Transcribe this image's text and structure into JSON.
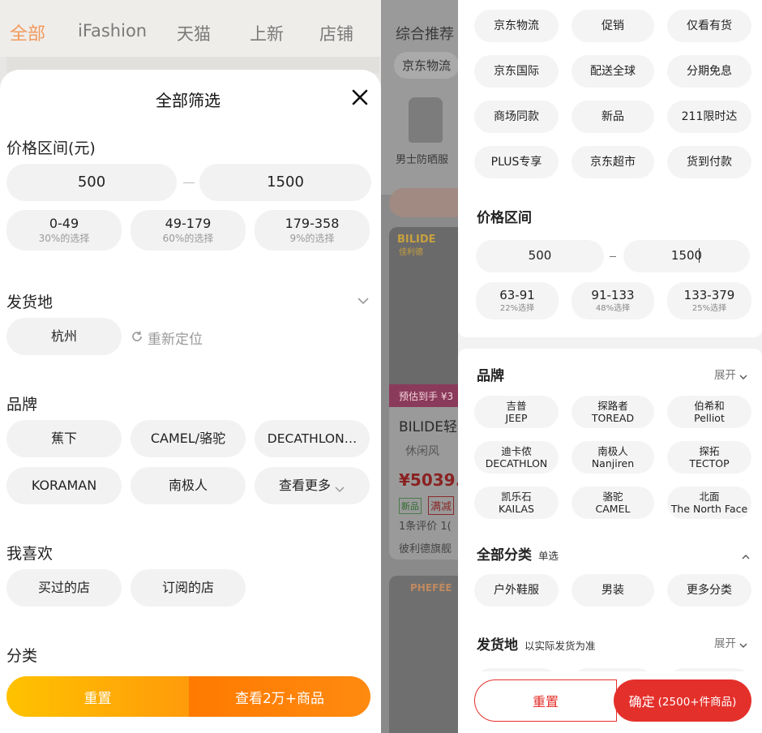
{
  "left_bg": {
    "tabs": [
      "全部",
      "iFashion",
      "天猫",
      "上新",
      "店铺"
    ]
  },
  "middle_bg": {
    "tab": "综合推荐",
    "chip": "京东物流",
    "item_label": "男士防晒服",
    "product_logo": "BILIDE",
    "product_logo_sub": "佳利德",
    "promo_text": "预估到手 ¥3",
    "product_title": "BILIDE轻",
    "product_style": "休闲风",
    "price": "¥5039.",
    "tags": [
      "新品",
      "满减"
    ],
    "review": "1条评价 1(",
    "shop": "彼利德旗舰",
    "product2_logo": "PHEFÉE"
  },
  "left_panel": {
    "title": "全部筛选",
    "price_section": "价格区间(元)",
    "price_min": "500",
    "price_max": "1500",
    "price_options": [
      {
        "range": "0-49",
        "share": "30%的选择"
      },
      {
        "range": "49-179",
        "share": "60%的选择"
      },
      {
        "range": "179-358",
        "share": "9%的选择"
      }
    ],
    "ship_section": "发货地",
    "ship_city": "杭州",
    "relocate": "重新定位",
    "brand_section": "品牌",
    "brands": [
      "蕉下",
      "CAMEL/骆驼",
      "DECATHLON…",
      "KORAMAN",
      "南极人"
    ],
    "more_label": "查看更多",
    "like_section": "我喜欢",
    "likes": [
      "买过的店",
      "订阅的店"
    ],
    "category_section": "分类",
    "reset_label": "重置",
    "view_label": "查看2万+商品",
    "colors": {
      "accent_start": "#ffc200",
      "accent_end": "#ff6a00"
    }
  },
  "right_panel": {
    "service_tags": [
      "京东物流",
      "促销",
      "仅看有货",
      "京东国际",
      "配送全球",
      "分期免息",
      "商场同款",
      "新品",
      "211限时达",
      "PLUS专享",
      "京东超市",
      "货到付款"
    ],
    "price_section": "价格区间",
    "price_min": "500",
    "price_max": "1500",
    "price_options": [
      {
        "range": "63-91",
        "share": "22%选择"
      },
      {
        "range": "91-133",
        "share": "48%选择"
      },
      {
        "range": "133-379",
        "share": "25%选择"
      }
    ],
    "brand_section": "品牌",
    "expand_label": "展开",
    "brands": [
      {
        "cn": "吉普",
        "en": "JEEP"
      },
      {
        "cn": "探路者",
        "en": "TOREAD"
      },
      {
        "cn": "伯希和",
        "en": "Pelliot"
      },
      {
        "cn": "迪卡侬",
        "en": "DECATHLON"
      },
      {
        "cn": "南极人",
        "en": "Nanjiren"
      },
      {
        "cn": "探拓",
        "en": "TECTOP"
      },
      {
        "cn": "凯乐石",
        "en": "KAILAS"
      },
      {
        "cn": "骆驼",
        "en": "CAMEL"
      },
      {
        "cn": "北面",
        "en": "The North Face"
      }
    ],
    "category_section": "全部分类",
    "category_note": "单选",
    "categories": [
      "户外鞋服",
      "男装",
      "更多分类"
    ],
    "ship_section": "发货地",
    "ship_note": "以实际发货为准",
    "reset_label": "重置",
    "confirm_label": "确定",
    "confirm_count": "(2500+件商品)",
    "colors": {
      "accent": "#e4302b"
    }
  }
}
